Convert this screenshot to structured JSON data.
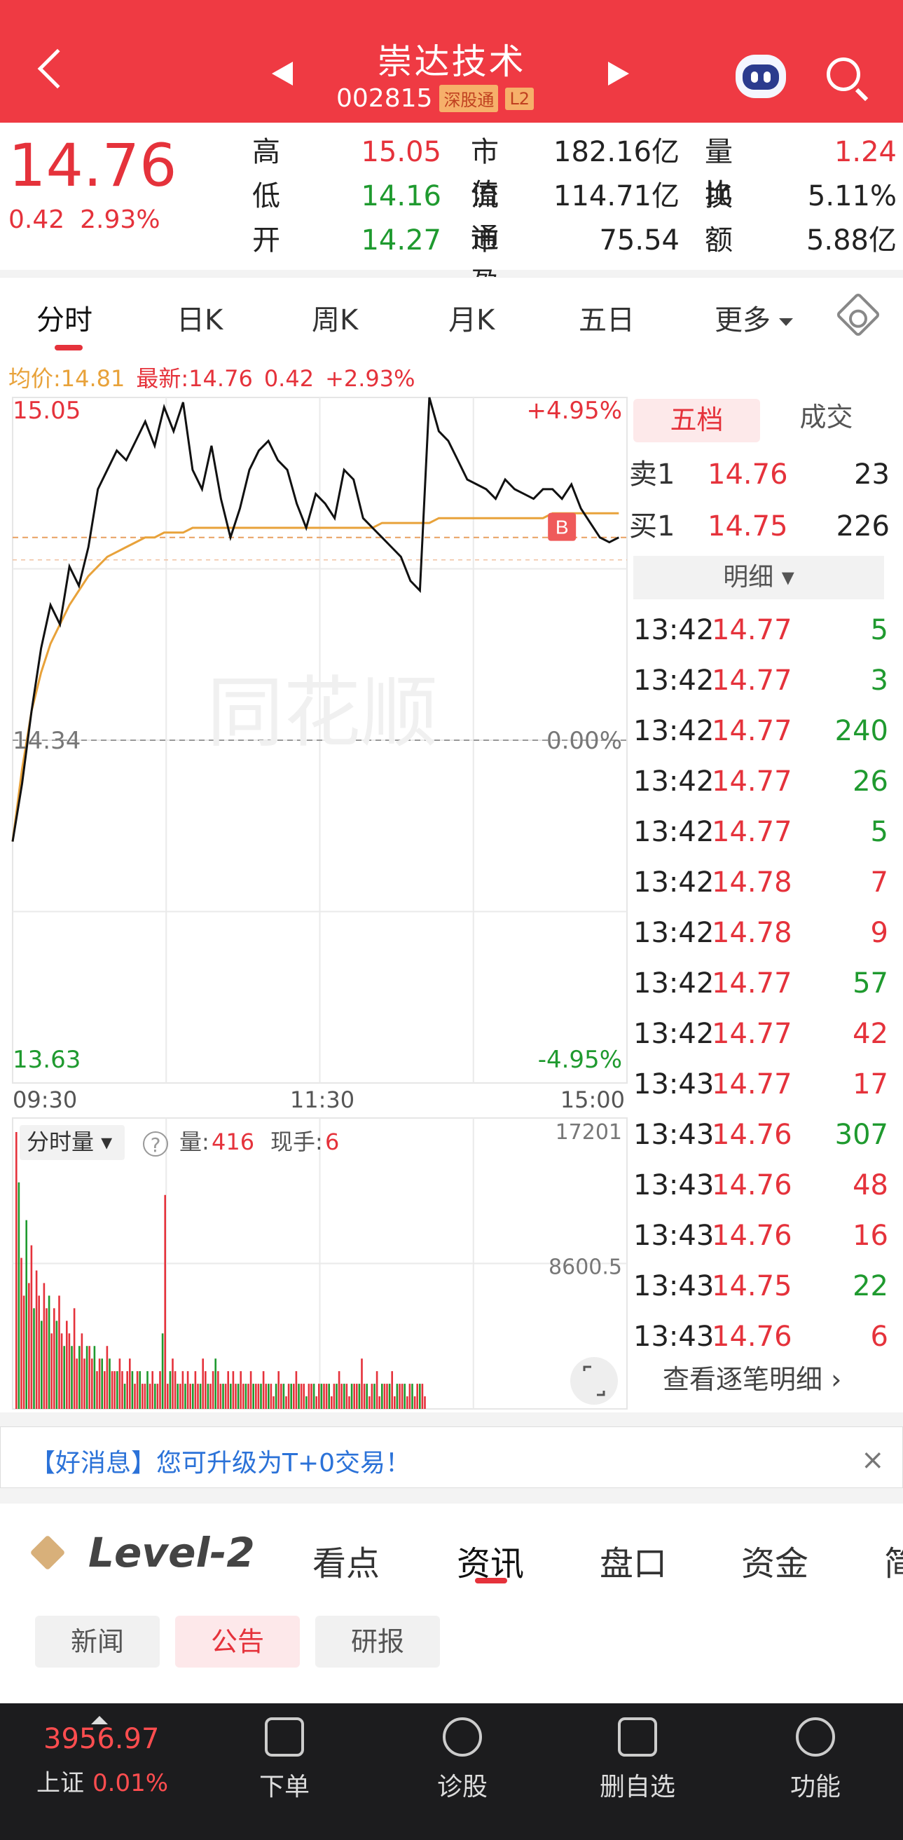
{
  "header": {
    "title": "崇达技术",
    "code": "002815",
    "tag1": "深股通",
    "tag2": "L2"
  },
  "quote": {
    "price": "14.76",
    "change": "0.42",
    "pct": "2.93%",
    "stats": [
      {
        "label": "高",
        "value": "15.05",
        "color": "red"
      },
      {
        "label": "低",
        "value": "14.16",
        "color": "green"
      },
      {
        "label": "开",
        "value": "14.27",
        "color": "green"
      },
      {
        "label": "市值",
        "value": "182.16亿",
        "color": "dark"
      },
      {
        "label": "流通",
        "value": "114.71亿",
        "color": "dark"
      },
      {
        "label": "市盈™",
        "value": "75.54",
        "color": "dark"
      },
      {
        "label": "量比",
        "value": "1.24",
        "color": "red"
      },
      {
        "label": "换",
        "value": "5.11%",
        "color": "dark"
      },
      {
        "label": "额",
        "value": "5.88亿",
        "color": "dark"
      }
    ]
  },
  "tabs": [
    "分时",
    "日K",
    "周K",
    "月K",
    "五日",
    "更多"
  ],
  "avg": {
    "avg_label": "均价:14.81",
    "latest_label": "最新:14.76",
    "change": "0.42",
    "pct": "+2.93%"
  },
  "chart_data": {
    "type": "line",
    "prev_close": 14.34,
    "ylim": [
      13.63,
      15.05
    ],
    "y_labels": {
      "top": "15.05",
      "mid": "14.34",
      "bottom": "13.63",
      "top_pct": "+4.95%",
      "mid_pct": "0.00%",
      "bottom_pct": "-4.95%"
    },
    "x_labels": [
      "09:30",
      "11:30",
      "15:00"
    ],
    "price": [
      14.13,
      14.25,
      14.4,
      14.53,
      14.62,
      14.58,
      14.7,
      14.66,
      14.74,
      14.86,
      14.9,
      14.94,
      14.92,
      14.96,
      15.0,
      14.95,
      15.03,
      14.98,
      15.04,
      14.9,
      14.86,
      14.95,
      14.84,
      14.76,
      14.82,
      14.9,
      14.94,
      14.96,
      14.92,
      14.9,
      14.83,
      14.78,
      14.85,
      14.83,
      14.8,
      14.9,
      14.88,
      14.8,
      14.78,
      14.76,
      14.74,
      14.72,
      14.67,
      14.65,
      15.05,
      14.98,
      14.96,
      14.92,
      14.88,
      14.87,
      14.86,
      14.84,
      14.88,
      14.86,
      14.85,
      14.84,
      14.86,
      14.86,
      14.84,
      14.87,
      14.82,
      14.79,
      14.76,
      14.75,
      14.76
    ],
    "avg": [
      14.13,
      14.28,
      14.4,
      14.48,
      14.54,
      14.58,
      14.62,
      14.65,
      14.68,
      14.7,
      14.72,
      14.73,
      14.74,
      14.75,
      14.76,
      14.76,
      14.77,
      14.77,
      14.77,
      14.78,
      14.78,
      14.78,
      14.78,
      14.78,
      14.78,
      14.78,
      14.78,
      14.78,
      14.78,
      14.78,
      14.78,
      14.78,
      14.78,
      14.78,
      14.78,
      14.78,
      14.78,
      14.78,
      14.78,
      14.79,
      14.79,
      14.79,
      14.79,
      14.79,
      14.79,
      14.8,
      14.8,
      14.8,
      14.8,
      14.8,
      14.8,
      14.8,
      14.8,
      14.8,
      14.8,
      14.8,
      14.8,
      14.81,
      14.81,
      14.81,
      14.81,
      14.81,
      14.81,
      14.81,
      14.81
    ],
    "total_points": 241,
    "buy_marker": {
      "label": "B",
      "index": 58
    }
  },
  "volume": {
    "label": "分时量",
    "vol_label": "量:",
    "vol_value": "416",
    "hand_label": "现手:",
    "hand_value": "6",
    "top": "17201",
    "mid": "8600.5",
    "bars": [
      22,
      18,
      12,
      9,
      15,
      10,
      13,
      8,
      11,
      9,
      7,
      10,
      8,
      9,
      6,
      8,
      7,
      9,
      6,
      5,
      7,
      6,
      5,
      8,
      4,
      5,
      6,
      4,
      5,
      5,
      4,
      5,
      3,
      4,
      4,
      3,
      5,
      4,
      3,
      3,
      3,
      4,
      3,
      2,
      3,
      4,
      3,
      2,
      3,
      3,
      2,
      2,
      3,
      2,
      3,
      2,
      2,
      3,
      6,
      17,
      2,
      3,
      4,
      3,
      2,
      2,
      3,
      2,
      3,
      2,
      2,
      3,
      2,
      2,
      4,
      3,
      2,
      2,
      3,
      4,
      3,
      2,
      2,
      2,
      3,
      2,
      3,
      2,
      2,
      3,
      2,
      2,
      2,
      3,
      2,
      2,
      2,
      2,
      3,
      2,
      2,
      2,
      1,
      2,
      3,
      2,
      2,
      1,
      2,
      2,
      2,
      3,
      2,
      2,
      2,
      1,
      2,
      2,
      2,
      1,
      2,
      2,
      2,
      2,
      2,
      1,
      2,
      2,
      3,
      2,
      2,
      2,
      1,
      2,
      2,
      2,
      2,
      4,
      2,
      2,
      1,
      2,
      2,
      3,
      1,
      2,
      2,
      2,
      2,
      3,
      1,
      2,
      2,
      2,
      2,
      1,
      2,
      2,
      1,
      2,
      2,
      2,
      1
    ]
  },
  "orderbook": {
    "tab_active": "五档",
    "tab_other": "成交",
    "sell": {
      "label": "卖1",
      "price": "14.76",
      "vol": "23"
    },
    "buy": {
      "label": "买1",
      "price": "14.75",
      "vol": "226"
    },
    "detail_label": "明细",
    "trades": [
      {
        "t": "13:42",
        "p": "14.77",
        "v": "5",
        "c": "green"
      },
      {
        "t": "13:42",
        "p": "14.77",
        "v": "3",
        "c": "green"
      },
      {
        "t": "13:42",
        "p": "14.77",
        "v": "240",
        "c": "green"
      },
      {
        "t": "13:42",
        "p": "14.77",
        "v": "26",
        "c": "green"
      },
      {
        "t": "13:42",
        "p": "14.77",
        "v": "5",
        "c": "green"
      },
      {
        "t": "13:42",
        "p": "14.78",
        "v": "7",
        "c": "red"
      },
      {
        "t": "13:42",
        "p": "14.78",
        "v": "9",
        "c": "red"
      },
      {
        "t": "13:42",
        "p": "14.77",
        "v": "57",
        "c": "green"
      },
      {
        "t": "13:42",
        "p": "14.77",
        "v": "42",
        "c": "red"
      },
      {
        "t": "13:43",
        "p": "14.77",
        "v": "17",
        "c": "red"
      },
      {
        "t": "13:43",
        "p": "14.76",
        "v": "307",
        "c": "green"
      },
      {
        "t": "13:43",
        "p": "14.76",
        "v": "48",
        "c": "red"
      },
      {
        "t": "13:43",
        "p": "14.76",
        "v": "16",
        "c": "red"
      },
      {
        "t": "13:43",
        "p": "14.75",
        "v": "22",
        "c": "green"
      },
      {
        "t": "13:43",
        "p": "14.76",
        "v": "6",
        "c": "red"
      }
    ],
    "more_label": "查看逐笔明细 ›"
  },
  "banner": {
    "text": "【好消息】您可升级为T+0交易！",
    "close": "×"
  },
  "content_tabs": {
    "level": "Level-2",
    "tabs": [
      "看点",
      "资讯",
      "盘口",
      "资金",
      "简"
    ],
    "subtabs": [
      "新闻",
      "公告",
      "研报"
    ]
  },
  "bottom": {
    "index_value": "3956.97",
    "index_name": "上证",
    "index_pct": "0.01%",
    "items": [
      "下单",
      "诊股",
      "删自选",
      "功能"
    ]
  },
  "colors": {
    "red": "#e5323b",
    "green": "#1f9a2f",
    "header": "#ef3a43",
    "avg_line": "#e8a23a"
  }
}
